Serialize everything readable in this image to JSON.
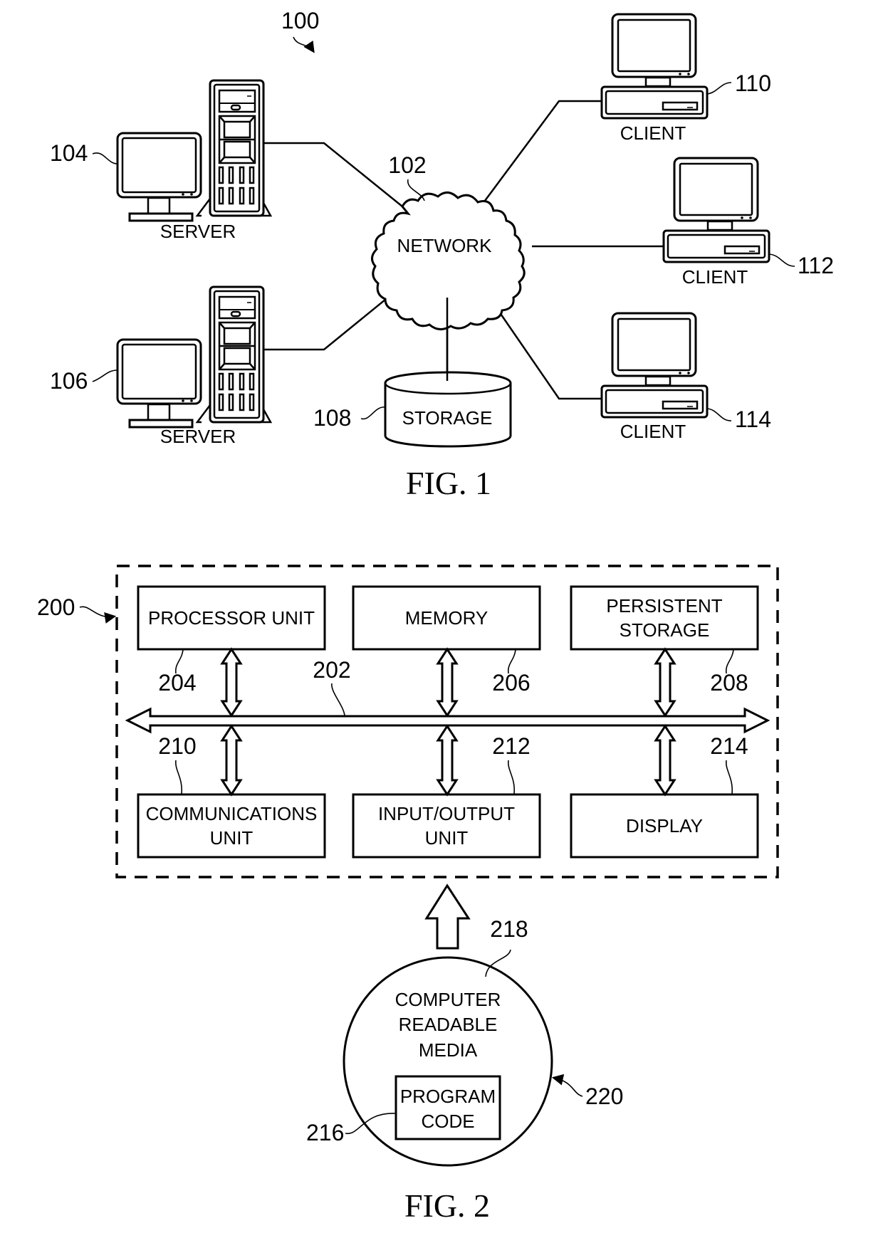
{
  "fig1": {
    "caption": "FIG. 1",
    "system_ref": "100",
    "network": {
      "label": "NETWORK",
      "ref": "102"
    },
    "servers": [
      {
        "label": "SERVER",
        "ref": "104"
      },
      {
        "label": "SERVER",
        "ref": "106"
      }
    ],
    "storage": {
      "label": "STORAGE",
      "ref": "108"
    },
    "clients": [
      {
        "label": "CLIENT",
        "ref": "110"
      },
      {
        "label": "CLIENT",
        "ref": "112"
      },
      {
        "label": "CLIENT",
        "ref": "114"
      }
    ]
  },
  "fig2": {
    "caption": "FIG. 2",
    "system_ref": "200",
    "bus_ref": "202",
    "components": [
      {
        "lines": [
          "PROCESSOR UNIT"
        ],
        "ref": "204"
      },
      {
        "lines": [
          "MEMORY"
        ],
        "ref": "206"
      },
      {
        "lines": [
          "PERSISTENT",
          "STORAGE"
        ],
        "ref": "208"
      },
      {
        "lines": [
          "COMMUNICATIONS",
          "UNIT"
        ],
        "ref": "210"
      },
      {
        "lines": [
          "INPUT/OUTPUT",
          "UNIT"
        ],
        "ref": "212"
      },
      {
        "lines": [
          "DISPLAY"
        ],
        "ref": "214"
      }
    ],
    "media": {
      "lines": [
        "COMPUTER",
        "READABLE",
        "MEDIA"
      ],
      "ref": "218"
    },
    "program_code": {
      "lines": [
        "PROGRAM",
        "CODE"
      ],
      "ref": "216"
    },
    "product_ref": "220"
  }
}
